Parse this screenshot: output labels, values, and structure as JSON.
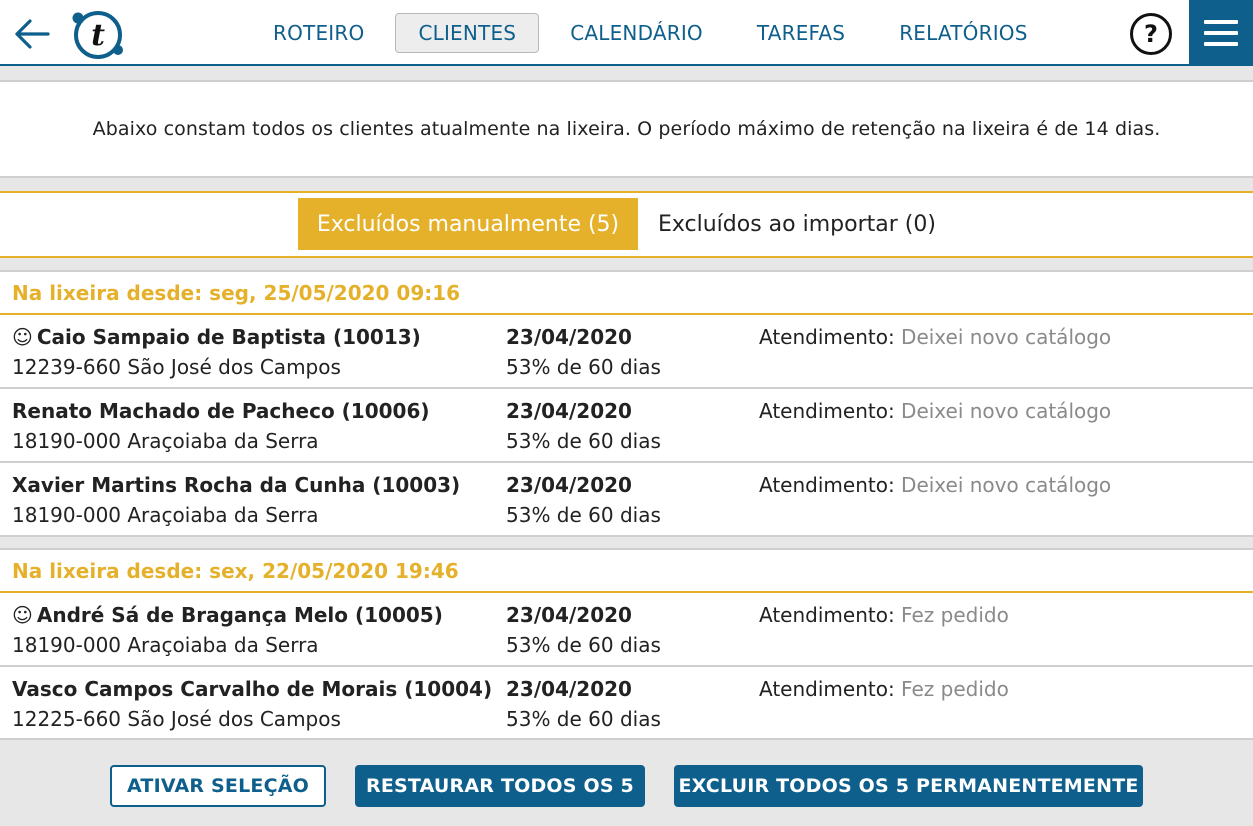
{
  "nav": {
    "items": [
      {
        "label": "ROTEIRO"
      },
      {
        "label": "CLIENTES"
      },
      {
        "label": "CALENDÁRIO"
      },
      {
        "label": "TAREFAS"
      },
      {
        "label": "RELATÓRIOS"
      }
    ],
    "active": "CLIENTES",
    "help_label": "?"
  },
  "info_text": "Abaixo constam todos os clientes atualmente na lixeira. O período máximo de retenção na lixeira é de 14 dias.",
  "tabs": {
    "manual": "Excluídos manualmente (5)",
    "import": "Excluídos ao importar (0)"
  },
  "groups": [
    {
      "header": "Na lixeira desde: seg, 25/05/2020 09:16",
      "rows": [
        {
          "icon": "☺",
          "name": "Caio Sampaio de Baptista (10013)",
          "address": "12239-660 São José dos Campos",
          "date": "23/04/2020",
          "pct": "53% de 60 dias",
          "atd_label": "Atendimento:",
          "atd_value": "Deixei novo catálogo"
        },
        {
          "icon": "",
          "name": "Renato Machado de Pacheco (10006)",
          "address": "18190-000 Araçoiaba da Serra",
          "date": "23/04/2020",
          "pct": "53% de 60 dias",
          "atd_label": "Atendimento:",
          "atd_value": "Deixei novo catálogo"
        },
        {
          "icon": "",
          "name": "Xavier Martins Rocha da Cunha (10003)",
          "address": "18190-000 Araçoiaba da Serra",
          "date": "23/04/2020",
          "pct": "53% de 60 dias",
          "atd_label": "Atendimento:",
          "atd_value": "Deixei novo catálogo"
        }
      ]
    },
    {
      "header": "Na lixeira desde: sex, 22/05/2020 19:46",
      "rows": [
        {
          "icon": "☺",
          "name": "André Sá de Bragança Melo (10005)",
          "address": "18190-000 Araçoiaba da Serra",
          "date": "23/04/2020",
          "pct": "53% de 60 dias",
          "atd_label": "Atendimento:",
          "atd_value": "Fez pedido"
        },
        {
          "icon": "",
          "name": "Vasco Campos Carvalho de Morais (10004)",
          "address": "12225-660 São José dos Campos",
          "date": "23/04/2020",
          "pct": "53% de 60 dias",
          "atd_label": "Atendimento:",
          "atd_value": "Fez pedido"
        }
      ]
    }
  ],
  "footer": {
    "activate": "ATIVAR SELEÇÃO",
    "restore": "RESTAURAR TODOS OS 5",
    "delete": "EXCLUIR TODOS OS 5 PERMANENTEMENTE"
  },
  "colors": {
    "primary": "#0f5f8c",
    "accent": "#e5b12b",
    "muted": "#8a8a8a"
  },
  "icons": {
    "back": "arrow-left-icon",
    "logo": "t-logo-icon",
    "help": "question-circle-icon",
    "menu": "hamburger-menu-icon",
    "client": "smiley-icon"
  }
}
